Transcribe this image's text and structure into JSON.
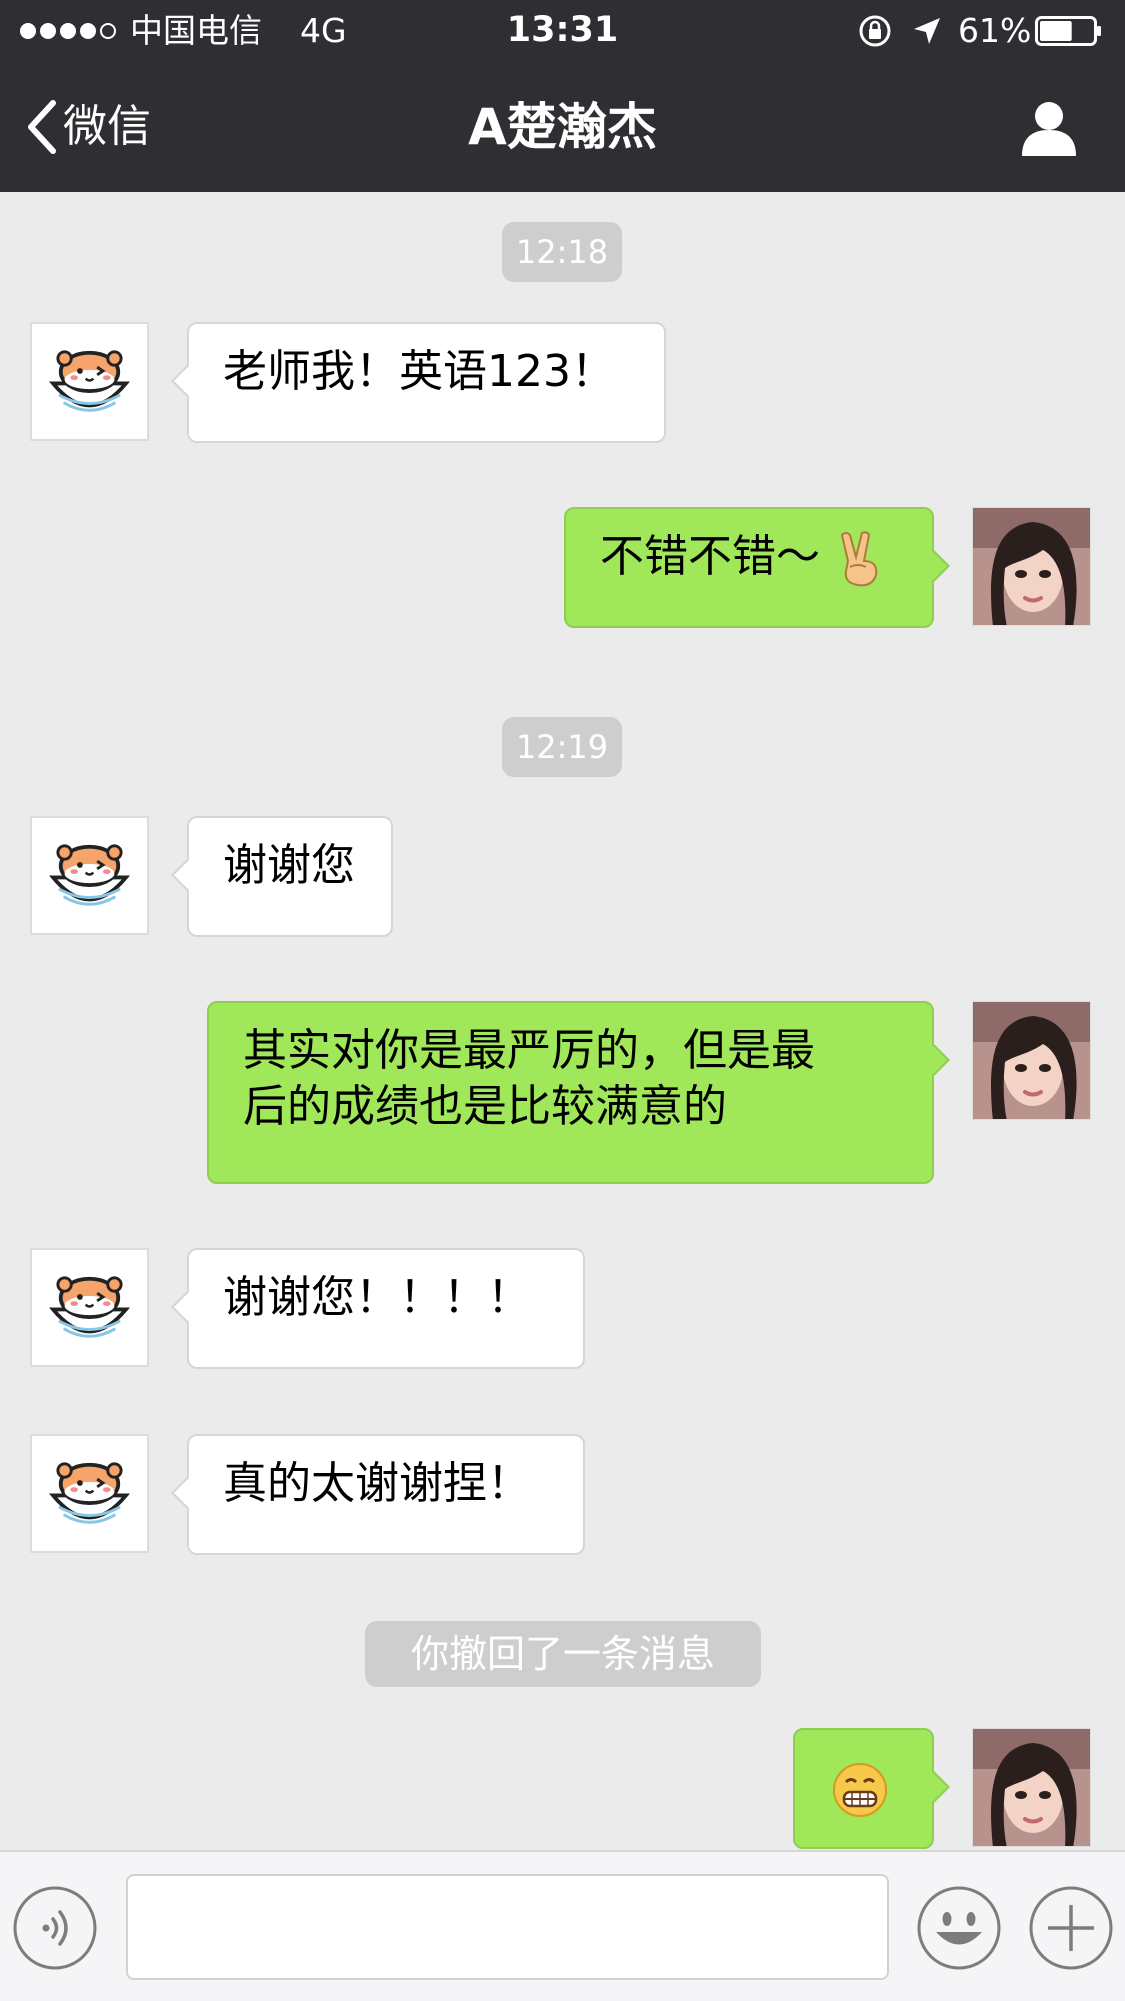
{
  "status_bar": {
    "carrier": "中国电信",
    "network": "4G",
    "time": "13:31",
    "battery_percent": "61%",
    "battery_level": 0.61,
    "signal_bars": 4,
    "signal_total": 5,
    "icons": [
      "orientation-lock-icon",
      "location-icon",
      "battery-icon"
    ]
  },
  "nav": {
    "back_label": "微信",
    "title": "A楚瀚杰",
    "icons": [
      "chevron-left-icon",
      "profile-icon"
    ]
  },
  "chat": {
    "timestamps": [
      "12:18",
      "12:19"
    ],
    "messages": [
      {
        "side": "left",
        "text": "老师我！英语123！"
      },
      {
        "side": "right",
        "text": "不错不错～",
        "emoji": "victory-hand-emoji"
      },
      {
        "side": "left",
        "text": "谢谢您"
      },
      {
        "side": "right",
        "lines": [
          "其实对你是最严厉的，但是最",
          "后的成绩也是比较满意的"
        ]
      },
      {
        "side": "left",
        "text": "谢谢您！！！！"
      },
      {
        "side": "left",
        "text": "真的太谢谢捏！"
      },
      {
        "side": "right",
        "emoji": "grin-emoji"
      }
    ],
    "recall_notice": "你撤回了一条消息"
  },
  "input_bar": {
    "icons": [
      "voice-icon",
      "emoji-icon",
      "plus-icon"
    ],
    "text_value": ""
  },
  "colors": {
    "header_bg": "#2f2f33",
    "chat_bg": "#ebebeb",
    "sent_bubble": "#a0e75a",
    "received_bubble": "#ffffff"
  }
}
